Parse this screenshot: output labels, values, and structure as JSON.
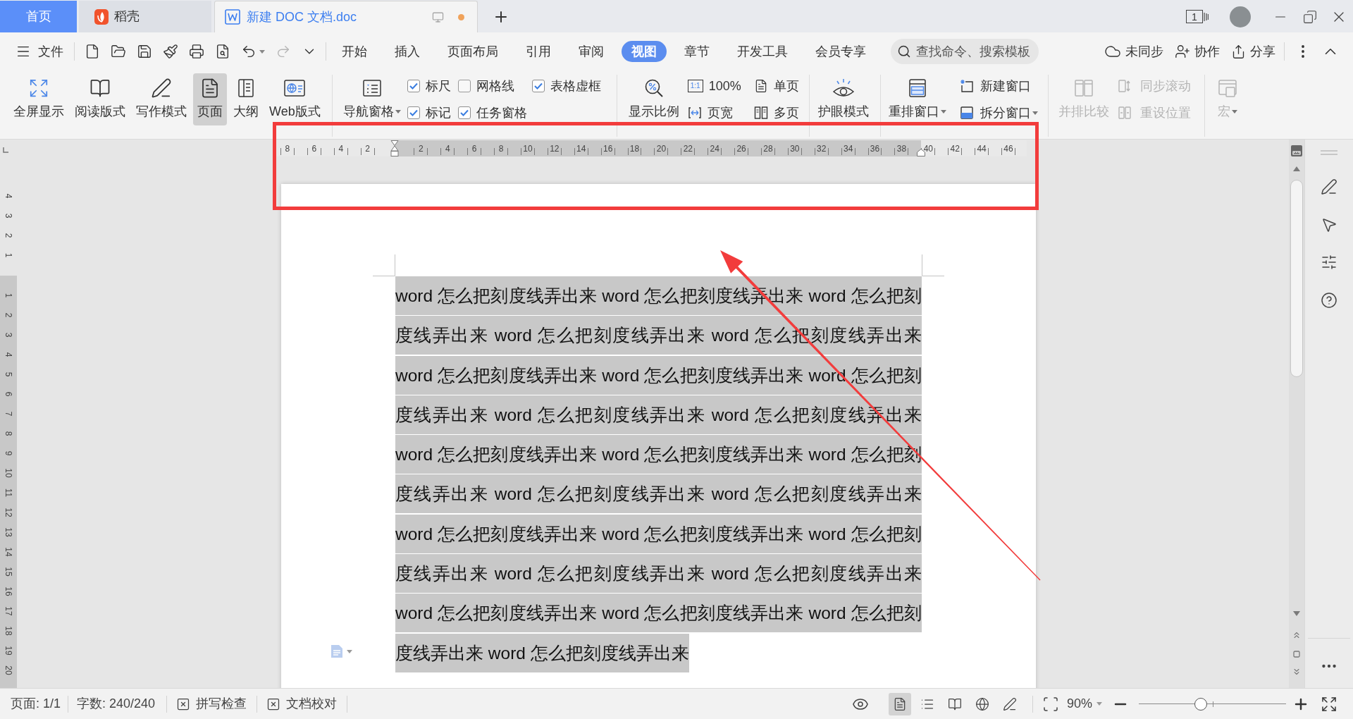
{
  "title_bar": {
    "tabs": [
      {
        "kind": "home",
        "label": "首页",
        "selected": false
      },
      {
        "kind": "app",
        "label": "稻壳",
        "selected": false
      },
      {
        "kind": "document",
        "label": "新建 DOC 文档.doc",
        "selected": true,
        "unsaved": true
      }
    ],
    "window_count": "1"
  },
  "menu_bar": {
    "file_menu": "文件",
    "tabs": [
      {
        "label": "开始",
        "selected": false
      },
      {
        "label": "插入",
        "selected": false
      },
      {
        "label": "页面布局",
        "selected": false
      },
      {
        "label": "引用",
        "selected": false
      },
      {
        "label": "审阅",
        "selected": false
      },
      {
        "label": "视图",
        "selected": true
      },
      {
        "label": "章节",
        "selected": false
      },
      {
        "label": "开发工具",
        "selected": false
      },
      {
        "label": "会员专享",
        "selected": false
      }
    ],
    "search": {
      "placeholder": "查找命令、搜索模板"
    },
    "actions": [
      {
        "kind": "sync",
        "label": "未同步"
      },
      {
        "kind": "collaborate",
        "label": "协作"
      },
      {
        "kind": "share",
        "label": "分享"
      }
    ]
  },
  "ribbon": {
    "view_modes": [
      {
        "kind": "fullscreen",
        "label": "全屏显示",
        "selected": false
      },
      {
        "kind": "reading",
        "label": "阅读版式",
        "selected": false
      },
      {
        "kind": "writing",
        "label": "写作模式",
        "selected": false
      },
      {
        "kind": "page",
        "label": "页面",
        "selected": true
      },
      {
        "kind": "outline",
        "label": "大纲",
        "selected": false
      },
      {
        "kind": "web",
        "label": "Web版式",
        "selected": false
      }
    ],
    "navigation_pane": {
      "label": "导航窗格"
    },
    "show_options": [
      {
        "label": "标尺",
        "checked": true
      },
      {
        "label": "网格线",
        "checked": false
      },
      {
        "label": "表格虚框",
        "checked": true
      },
      {
        "label": "标记",
        "checked": true
      },
      {
        "label": "任务窗格",
        "checked": true
      }
    ],
    "zoom": {
      "label": "显示比例"
    },
    "zoom_options": [
      {
        "kind": "actual_size",
        "badge": "1:1",
        "label": "100%"
      },
      {
        "kind": "single_page",
        "label": "单页"
      },
      {
        "kind": "page_width",
        "label": "页宽"
      },
      {
        "kind": "multi_page",
        "label": "多页"
      }
    ],
    "eye_protection": {
      "label": "护眼模式"
    },
    "arrange_windows": {
      "label": "重排窗口"
    },
    "window_options": [
      {
        "kind": "new_window",
        "label": "新建窗口"
      },
      {
        "kind": "split_window",
        "label": "拆分窗口"
      }
    ],
    "side_by_side": {
      "label": "并排比较",
      "disabled": true
    },
    "sync_options": [
      {
        "kind": "sync_scroll",
        "label": "同步滚动",
        "disabled": true
      },
      {
        "kind": "reset_position",
        "label": "重设位置",
        "disabled": true
      }
    ],
    "macro": {
      "label": "宏",
      "disabled": true
    }
  },
  "horizontal_ruler": {
    "left_labels": [
      "8",
      "6",
      "4",
      "2"
    ],
    "right_labels": [
      "2",
      "4",
      "6",
      "8",
      "10",
      "12",
      "14",
      "16",
      "18",
      "20",
      "22",
      "24",
      "26",
      "28",
      "30",
      "32",
      "34",
      "36",
      "38",
      "40",
      "42",
      "44",
      "46"
    ]
  },
  "vertical_ruler": {
    "top_labels": [
      "4",
      "3",
      "2",
      "1"
    ],
    "body_labels": [
      "1",
      "2",
      "3",
      "4",
      "5",
      "6",
      "7",
      "8",
      "9",
      "10",
      "11",
      "12",
      "13",
      "14",
      "15",
      "16",
      "17",
      "18",
      "19",
      "20"
    ]
  },
  "document": {
    "paragraph": "word 怎么把刻度线弄出来 word 怎么把刻度线弄出来 word 怎么把刻度线弄出来 word 怎么把刻度线弄出来 word 怎么把刻度线弄出来 word 怎么把刻度线弄出来 word 怎么把刻度线弄出来 word 怎么把刻度线弄出来 word 怎么把刻度线弄出来 word 怎么把刻度线弄出来 word 怎么把刻度线弄出来 word 怎么把刻度线弄出来 word 怎么把刻度线弄出来 word 怎么把刻度线弄出来 word 怎么把刻度线弄出来 word 怎么把刻度线弄出来 word 怎么把刻度线弄出来 word 怎么把刻度线弄出来 word 怎么把刻度线弄出来 word 怎么把刻度线弄出来 word 怎么把刻度线弄出来 word 怎么把刻度线弄出来 word 怎么把刻度线弄出来 word 怎么把刻度线弄出来",
    "selected": true
  },
  "status_bar": {
    "page": "页面: 1/1",
    "word_count": "字数: 240/240",
    "tools": [
      {
        "label": "拼写检查"
      },
      {
        "label": "文档校对"
      }
    ],
    "views": [
      {
        "kind": "page",
        "selected": true
      },
      {
        "kind": "outline",
        "selected": false
      },
      {
        "kind": "reading",
        "selected": false
      },
      {
        "kind": "web",
        "selected": false
      },
      {
        "kind": "writing",
        "selected": false
      }
    ],
    "zoom": {
      "reading": "90%",
      "level": 0.42
    }
  }
}
